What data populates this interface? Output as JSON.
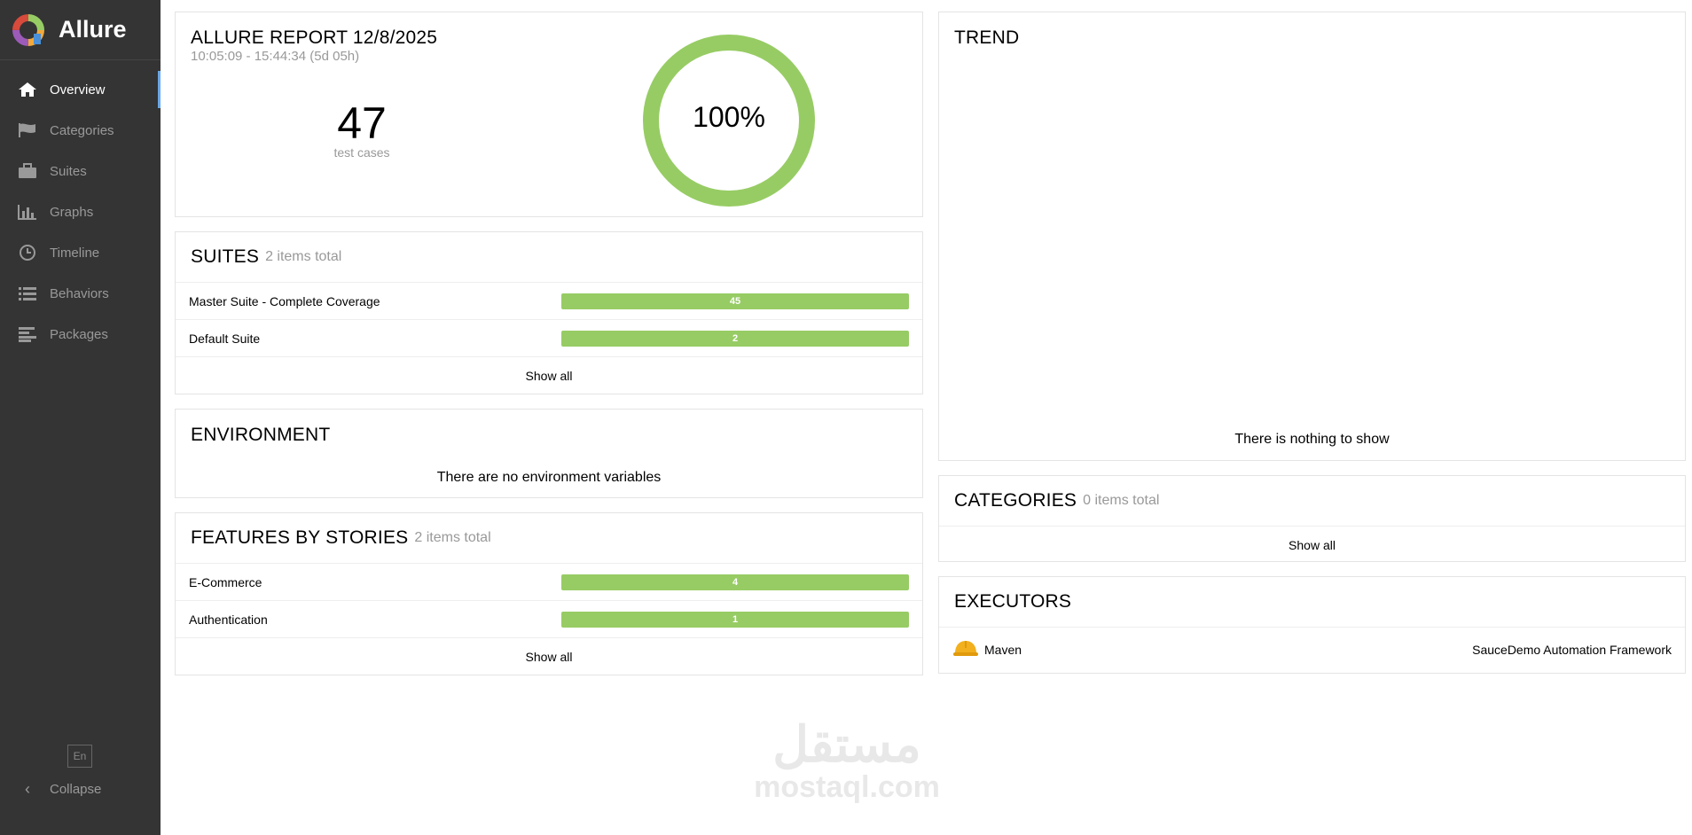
{
  "app": {
    "name": "Allure",
    "brand_colors": [
      "#d84a3c",
      "#f2a93b",
      "#97cc64",
      "#4a90d9",
      "#9c5bb8"
    ]
  },
  "sidebar": {
    "items": [
      {
        "label": "Overview",
        "icon": "home-icon",
        "active": true
      },
      {
        "label": "Categories",
        "icon": "flag-icon"
      },
      {
        "label": "Suites",
        "icon": "briefcase-icon"
      },
      {
        "label": "Graphs",
        "icon": "bar-chart-icon"
      },
      {
        "label": "Timeline",
        "icon": "clock-icon"
      },
      {
        "label": "Behaviors",
        "icon": "list-icon"
      },
      {
        "label": "Packages",
        "icon": "align-left-icon"
      }
    ],
    "lang": "En",
    "collapse": "Collapse"
  },
  "summary": {
    "title": "ALLURE REPORT 12/8/2025",
    "time_range": "10:05:09 - 15:44:34 (5d 05h)",
    "count": "47",
    "count_label": "test cases",
    "percent": "100%",
    "percent_value": 1.0,
    "ring_color": "#97cc64"
  },
  "suites": {
    "title": "SUITES",
    "total": "2 items total",
    "rows": [
      {
        "name": "Master Suite - Complete Coverage",
        "value": "45"
      },
      {
        "name": "Default Suite",
        "value": "2"
      }
    ],
    "show_all": "Show all"
  },
  "environment": {
    "title": "ENVIRONMENT",
    "empty": "There are no environment variables"
  },
  "features": {
    "title": "FEATURES BY STORIES",
    "total": "2 items total",
    "rows": [
      {
        "name": "E-Commerce",
        "value": "4"
      },
      {
        "name": "Authentication",
        "value": "1"
      }
    ],
    "show_all": "Show all"
  },
  "trend": {
    "title": "TREND",
    "empty": "There is nothing to show"
  },
  "categories": {
    "title": "CATEGORIES",
    "total": "0 items total",
    "show_all": "Show all"
  },
  "executors": {
    "title": "EXECUTORS",
    "name": "Maven",
    "icon": "hard-hat-icon",
    "build": "SauceDemo Automation Framework"
  },
  "watermark": {
    "arabic": "مستقل",
    "latin": "mostaql.com"
  }
}
